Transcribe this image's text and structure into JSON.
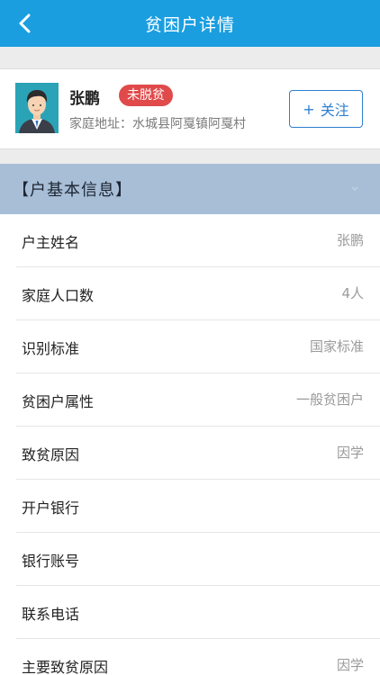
{
  "header": {
    "title": "贫困户详情"
  },
  "profile": {
    "name": "张鹏",
    "status_badge": "未脱贫",
    "address": "家庭地址：水城县阿戛镇阿戛村",
    "follow_plus": "+",
    "follow_label": "关注"
  },
  "section": {
    "title": "【户基本信息】"
  },
  "rows": [
    {
      "label": "户主姓名",
      "value": "张鹏"
    },
    {
      "label": "家庭人口数",
      "value": "4人"
    },
    {
      "label": "识别标准",
      "value": "国家标准"
    },
    {
      "label": "贫困户属性",
      "value": "一般贫困户"
    },
    {
      "label": "致贫原因",
      "value": "因学"
    },
    {
      "label": "开户银行",
      "value": ""
    },
    {
      "label": "银行账号",
      "value": ""
    },
    {
      "label": "联系电话",
      "value": ""
    },
    {
      "label": "主要致贫原因",
      "value": "因学"
    }
  ],
  "colors": {
    "header_bg": "#1a9ee0",
    "section_bg": "#a7bed6",
    "badge_bg": "#e04a4a",
    "follow_accent": "#2f7fd0"
  },
  "icons": {
    "back": "chevron-left-icon",
    "section_toggle": "chevron-down-icon",
    "avatar": "user-avatar"
  }
}
